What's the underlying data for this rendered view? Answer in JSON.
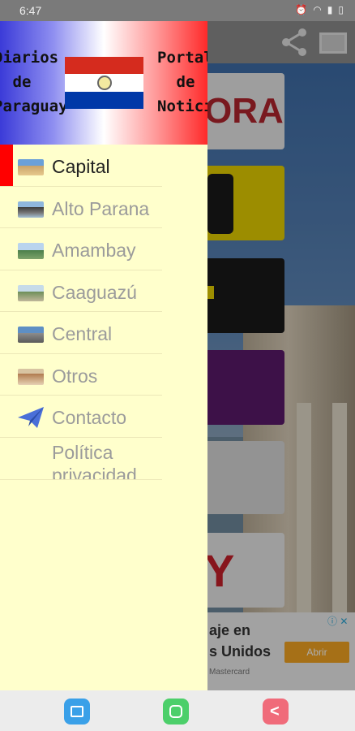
{
  "status_bar": {
    "time": "6:47",
    "icons": [
      "alarm-icon",
      "wifi-icon",
      "signal-icon",
      "battery-icon"
    ]
  },
  "drawer": {
    "header": {
      "left_text": [
        "Diarios",
        "de",
        "Paraguay"
      ],
      "right_text": [
        "Portales",
        "de",
        "Noticias"
      ]
    },
    "items": [
      {
        "label": "Capital",
        "icon": "capital-photo-icon",
        "active": true
      },
      {
        "label": "Alto Parana",
        "icon": "alto-parana-photo-icon",
        "active": false
      },
      {
        "label": "Amambay",
        "icon": "amambay-photo-icon",
        "active": false
      },
      {
        "label": "Caaguazú",
        "icon": "caaguazu-photo-icon",
        "active": false
      },
      {
        "label": "Central",
        "icon": "central-photo-icon",
        "active": false
      },
      {
        "label": "Otros",
        "icon": "otros-photo-icon",
        "active": false
      },
      {
        "label": "Contacto",
        "icon": "paper-plane-icon",
        "active": false
      },
      {
        "label": "Política privacidad",
        "icon": "",
        "active": false
      }
    ]
  },
  "background": {
    "card1_text": "ORA",
    "card6_text": "Y",
    "ad": {
      "line1": "aje en",
      "line2": "s Unidos",
      "brand": "Mastercard",
      "button": "Abrir"
    }
  },
  "colors": {
    "drawer_bg": "#ffffcc",
    "active_marker": "#ff0000",
    "inactive_text": "#9b9b9b"
  }
}
